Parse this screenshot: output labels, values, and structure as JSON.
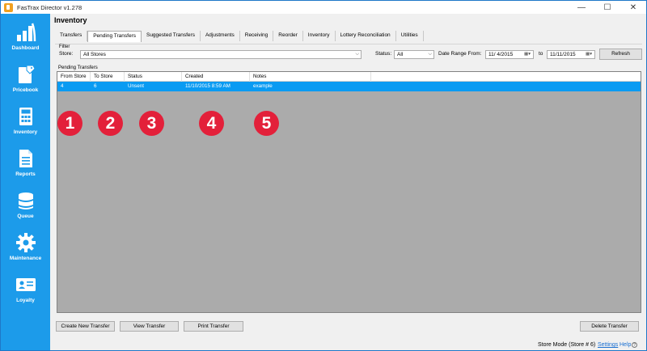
{
  "window": {
    "title": "FasTrax Director v1.278",
    "controls": {
      "minimize": "—",
      "maximize": "☐",
      "close": "✕"
    }
  },
  "sidebar": {
    "items": [
      {
        "label": "Dashboard",
        "icon": "dashboard-bars-icon"
      },
      {
        "label": "Pricebook",
        "icon": "pricebook-tag-icon"
      },
      {
        "label": "Inventory",
        "icon": "calculator-icon"
      },
      {
        "label": "Reports",
        "icon": "document-icon"
      },
      {
        "label": "Queue",
        "icon": "stack-icon"
      },
      {
        "label": "Maintenance",
        "icon": "gear-icon"
      },
      {
        "label": "Loyalty",
        "icon": "id-card-icon"
      }
    ]
  },
  "page": {
    "title": "Inventory"
  },
  "tabs": [
    "Transfers",
    "Pending Transfers",
    "Suggested Transfers",
    "Adjustments",
    "Receiving",
    "Reorder",
    "Inventory",
    "Lottery Reconciliation",
    "Utilities"
  ],
  "active_tab": "Pending Transfers",
  "filter": {
    "legend": "Filter",
    "store_label": "Store:",
    "store_value": "All Stores",
    "status_label": "Status:",
    "status_value": "All",
    "date_range_label": "Date Range From:",
    "date_from": "11/  4/2015",
    "to_label": "to",
    "date_to": "11/11/2015",
    "refresh_label": "Refresh"
  },
  "grid": {
    "group_label": "Pending Transfers",
    "columns": [
      "From Store",
      "To Store",
      "Status",
      "Created",
      "Notes"
    ],
    "rows": [
      {
        "from_store": "4",
        "to_store": "6",
        "status": "Unsent",
        "created": "11/10/2015 8:59 AM",
        "notes": "example"
      }
    ]
  },
  "annotations": [
    "1",
    "2",
    "3",
    "4",
    "5"
  ],
  "buttons": {
    "create": "Create New Transfer",
    "view": "View Transfer",
    "print": "Print Transfer",
    "delete": "Delete Transfer"
  },
  "statusbar": {
    "mode": "Store Mode (Store # 6)",
    "settings": "Settings",
    "help": "Help",
    "help_icon": "?"
  },
  "colors": {
    "sidebar": "#1c9bea",
    "selected_row": "#0a9bf2",
    "badge": "#e3203a",
    "link": "#1a6fd1"
  }
}
